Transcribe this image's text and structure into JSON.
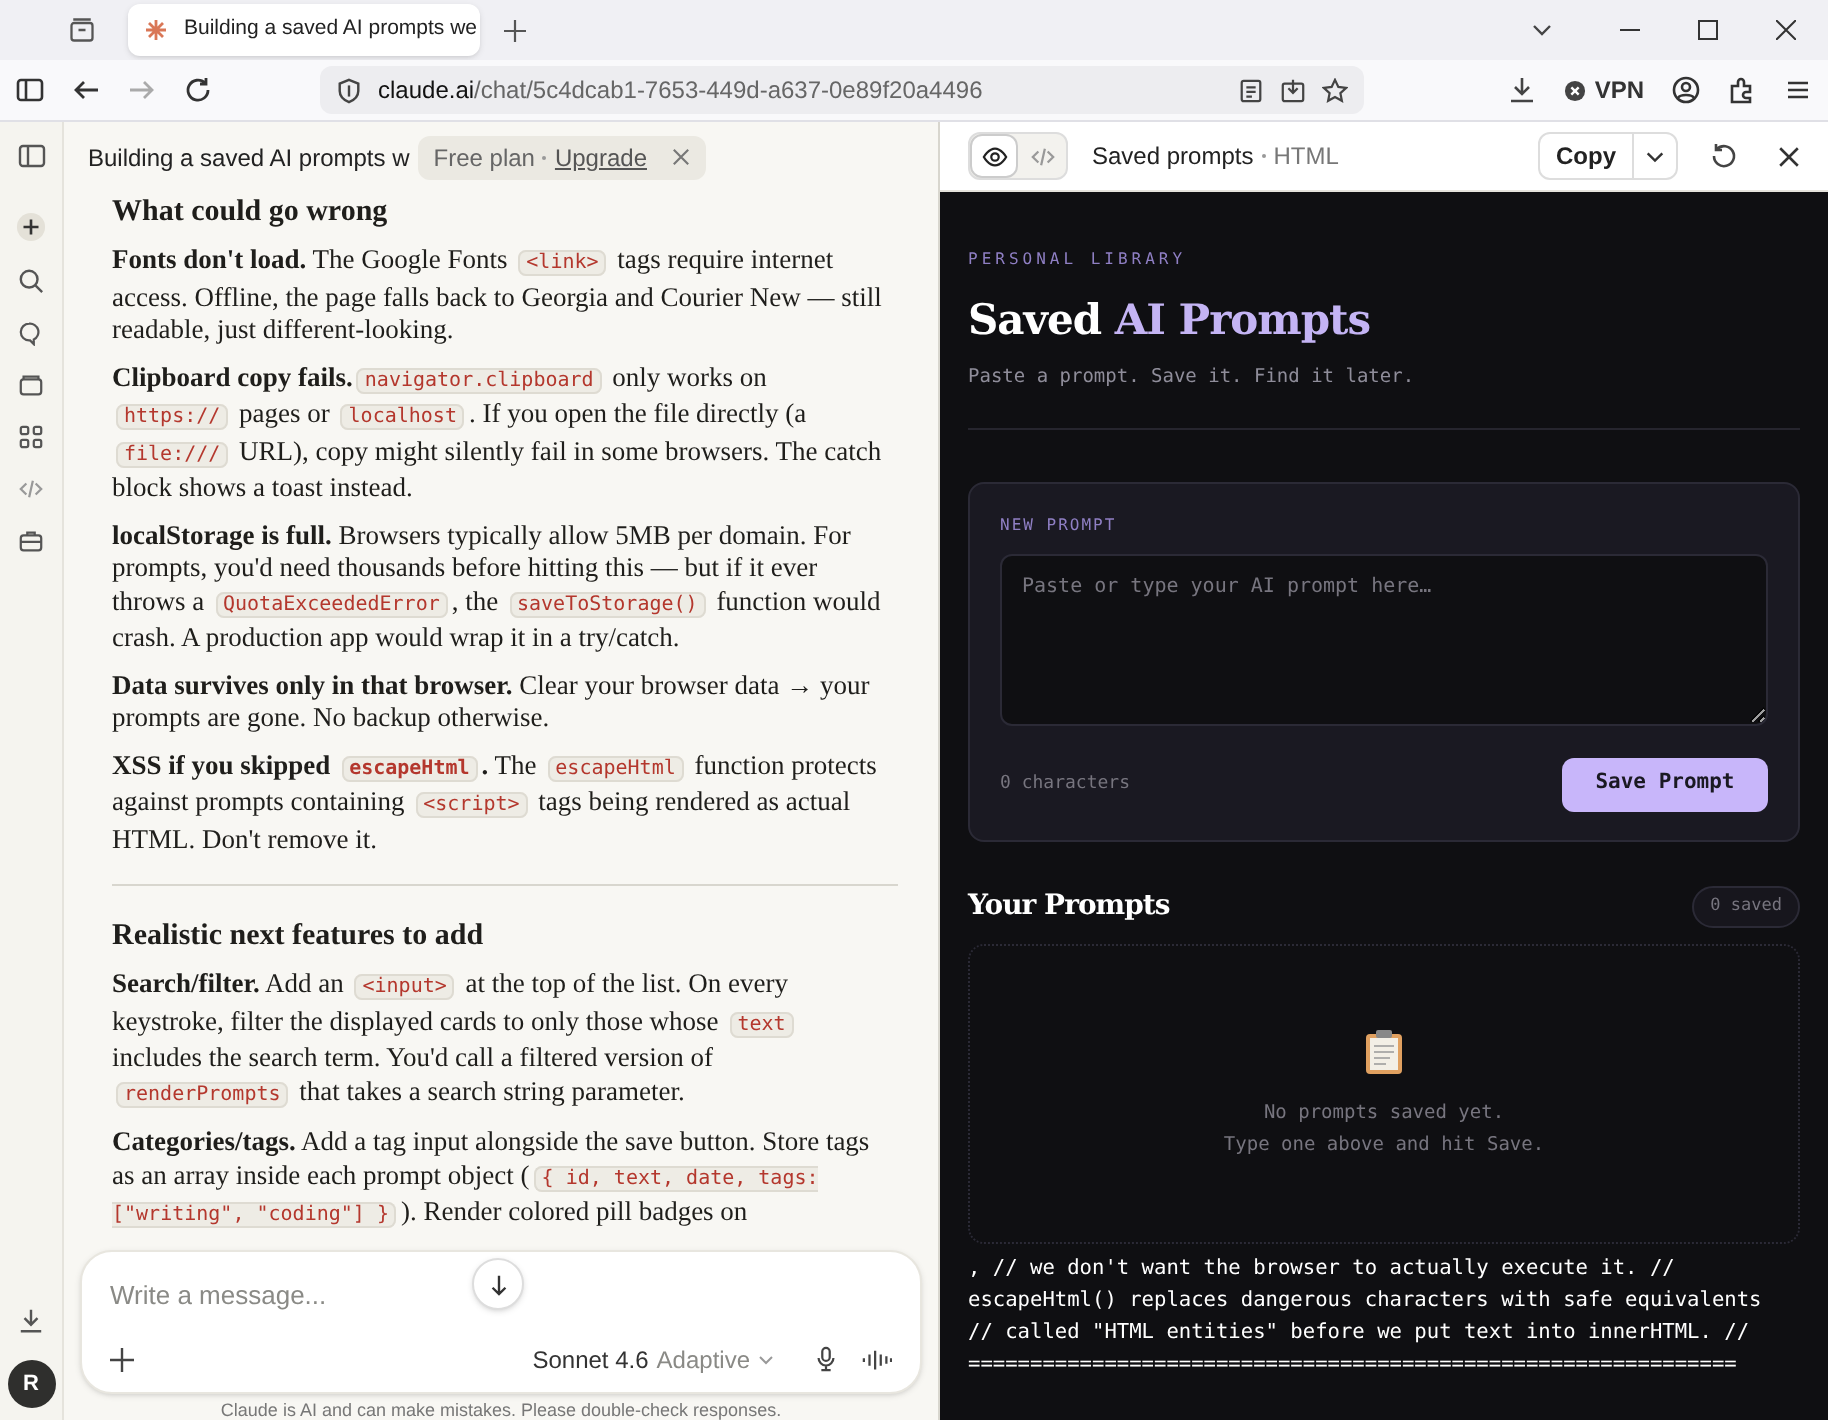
{
  "browser": {
    "tab_title": "Building a saved AI prompts we",
    "url_host": "claude.ai",
    "url_path": "/chat/5c4dcab1-7653-449d-a637-0e89f20a4496",
    "vpn_label": "VPN"
  },
  "chat": {
    "title": "Building a saved AI prompts w",
    "plan": "Free plan",
    "upgrade": "Upgrade",
    "sections": [
      {
        "heading": "What could go wrong",
        "paragraphs": [
          [
            {
              "kind": "bold",
              "text": "Fonts don't load."
            },
            {
              "kind": "text",
              "text": " The Google Fonts "
            },
            {
              "kind": "code",
              "text": "<link>"
            },
            {
              "kind": "text",
              "text": " tags require internet access. Offline, the page falls back to Georgia and Courier New — still readable, just different-looking."
            }
          ],
          [
            {
              "kind": "bold",
              "text": "Clipboard copy fails."
            },
            {
              "kind": "code",
              "text": "navigator.clipboard"
            },
            {
              "kind": "text",
              "text": " only works on "
            },
            {
              "kind": "code",
              "text": "https://"
            },
            {
              "kind": "text",
              "text": " pages or "
            },
            {
              "kind": "code",
              "text": "localhost"
            },
            {
              "kind": "text",
              "text": ". If you open the file directly (a "
            },
            {
              "kind": "code",
              "text": "file:///"
            },
            {
              "kind": "text",
              "text": " URL), copy might silently fail in some browsers. The catch block shows a toast instead."
            }
          ],
          [
            {
              "kind": "bold",
              "text": "localStorage is full."
            },
            {
              "kind": "text",
              "text": " Browsers typically allow 5MB per domain. For prompts, you'd need thousands before hitting this — but if it ever throws a "
            },
            {
              "kind": "code",
              "text": "QuotaExceededError"
            },
            {
              "kind": "text",
              "text": ", the "
            },
            {
              "kind": "code",
              "text": "saveToStorage()"
            },
            {
              "kind": "text",
              "text": " function would crash. A production app would wrap it in a try/catch."
            }
          ],
          [
            {
              "kind": "bold",
              "text": "Data survives only in that browser."
            },
            {
              "kind": "text",
              "text": " Clear your browser data → your prompts are gone. No backup otherwise."
            }
          ],
          [
            {
              "kind": "bold",
              "text": "XSS if you skipped "
            },
            {
              "kind": "boldcode",
              "text": "escapeHtml"
            },
            {
              "kind": "bold",
              "text": "."
            },
            {
              "kind": "text",
              "text": " The "
            },
            {
              "kind": "code",
              "text": "escapeHtml"
            },
            {
              "kind": "text",
              "text": " function protects against prompts containing "
            },
            {
              "kind": "code",
              "text": "<script>"
            },
            {
              "kind": "text",
              "text": " tags being rendered as actual HTML. Don't remove it."
            }
          ]
        ]
      },
      {
        "heading": "Realistic next features to add",
        "paragraphs": [
          [
            {
              "kind": "bold",
              "text": "Search/filter."
            },
            {
              "kind": "text",
              "text": " Add an "
            },
            {
              "kind": "code",
              "text": "<input>"
            },
            {
              "kind": "text",
              "text": " at the top of the list. On every keystroke, filter the displayed cards to only those whose "
            },
            {
              "kind": "code",
              "text": "text"
            },
            {
              "kind": "text",
              "text": " includes the search term. You'd call a filtered version of "
            },
            {
              "kind": "code",
              "text": "renderPrompts"
            },
            {
              "kind": "text",
              "text": " that takes a search string parameter."
            }
          ],
          [
            {
              "kind": "bold",
              "text": "Categories/tags."
            },
            {
              "kind": "text",
              "text": " Add a tag input alongside the save button. Store tags as an array inside each prompt object ("
            },
            {
              "kind": "code",
              "text": "{ id, text, date, tags: [\"writing\", \"coding\"] }"
            },
            {
              "kind": "text",
              "text": "). Render colored pill badges on"
            }
          ]
        ]
      }
    ],
    "composer": {
      "placeholder": "Write a message...",
      "model": "Sonnet 4.6",
      "mode": "Adaptive"
    },
    "disclaimer": "Claude is AI and can make mistakes. Please double-check responses.",
    "avatar_initial": "R"
  },
  "artifact": {
    "title": "Saved prompts",
    "type": "HTML",
    "copy_label": "Copy",
    "view_tabs": [
      {
        "kind": "preview",
        "selected": true
      },
      {
        "kind": "code",
        "selected": false
      }
    ],
    "eyebrow": "PERSONAL LIBRARY",
    "heading_plain": "Saved ",
    "heading_accent": "AI Prompts",
    "tagline": "Paste a prompt. Save it. Find it later.",
    "form_label": "NEW PROMPT",
    "textarea_placeholder": "Paste or type your AI prompt here…",
    "char_count": "0 characters",
    "save_label": "Save Prompt",
    "list_heading": "Your Prompts",
    "saved_count": "0 saved",
    "empty_lines": [
      "No prompts saved yet.",
      "Type one above and hit Save."
    ],
    "code_lines": [
      ", // we don't want the browser to actually execute it. //",
      "escapeHtml() replaces dangerous characters with safe equivalents",
      "// called \"HTML entities\" before we put text into innerHTML. //",
      "=============================================================="
    ]
  }
}
